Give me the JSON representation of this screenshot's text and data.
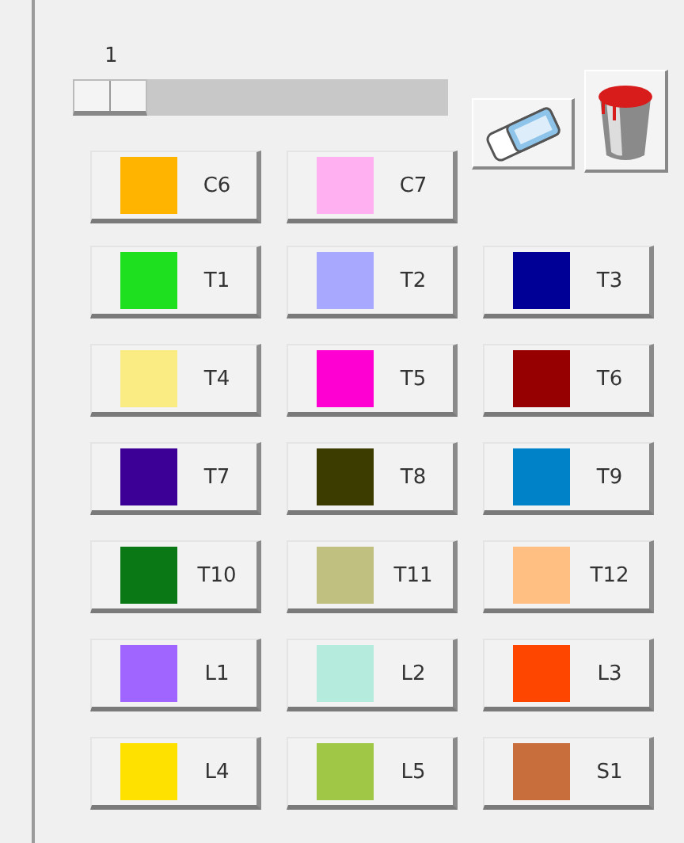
{
  "slider": {
    "reading": "1",
    "level": 0
  },
  "tools": [
    {
      "kind": "eraser"
    },
    {
      "kind": "bucket"
    }
  ],
  "top_colors": [
    {
      "label": "C6",
      "color": "#ffb400"
    },
    {
      "label": "C7",
      "color": "#ffb0f0"
    }
  ],
  "colors": [
    {
      "label": "T1",
      "color": "#1ee01e"
    },
    {
      "label": "T2",
      "color": "#a8a8ff"
    },
    {
      "label": "T3",
      "color": "#000096"
    },
    {
      "label": "T4",
      "color": "#faeb82"
    },
    {
      "label": "T5",
      "color": "#ff00d2"
    },
    {
      "label": "T6",
      "color": "#960000"
    },
    {
      "label": "T7",
      "color": "#3c0096"
    },
    {
      "label": "T8",
      "color": "#3c3c00"
    },
    {
      "label": "T9",
      "color": "#0082c8"
    },
    {
      "label": "T10",
      "color": "#0a7814"
    },
    {
      "label": "T11",
      "color": "#c0c080"
    },
    {
      "label": "T12",
      "color": "#ffbe82"
    },
    {
      "label": "L1",
      "color": "#a064ff"
    },
    {
      "label": "L2",
      "color": "#b4ebdc"
    },
    {
      "label": "L3",
      "color": "#ff4600"
    },
    {
      "label": "L4",
      "color": "#ffe100"
    },
    {
      "label": "L5",
      "color": "#a0c846"
    },
    {
      "label": "S1",
      "color": "#c86e3c"
    }
  ]
}
